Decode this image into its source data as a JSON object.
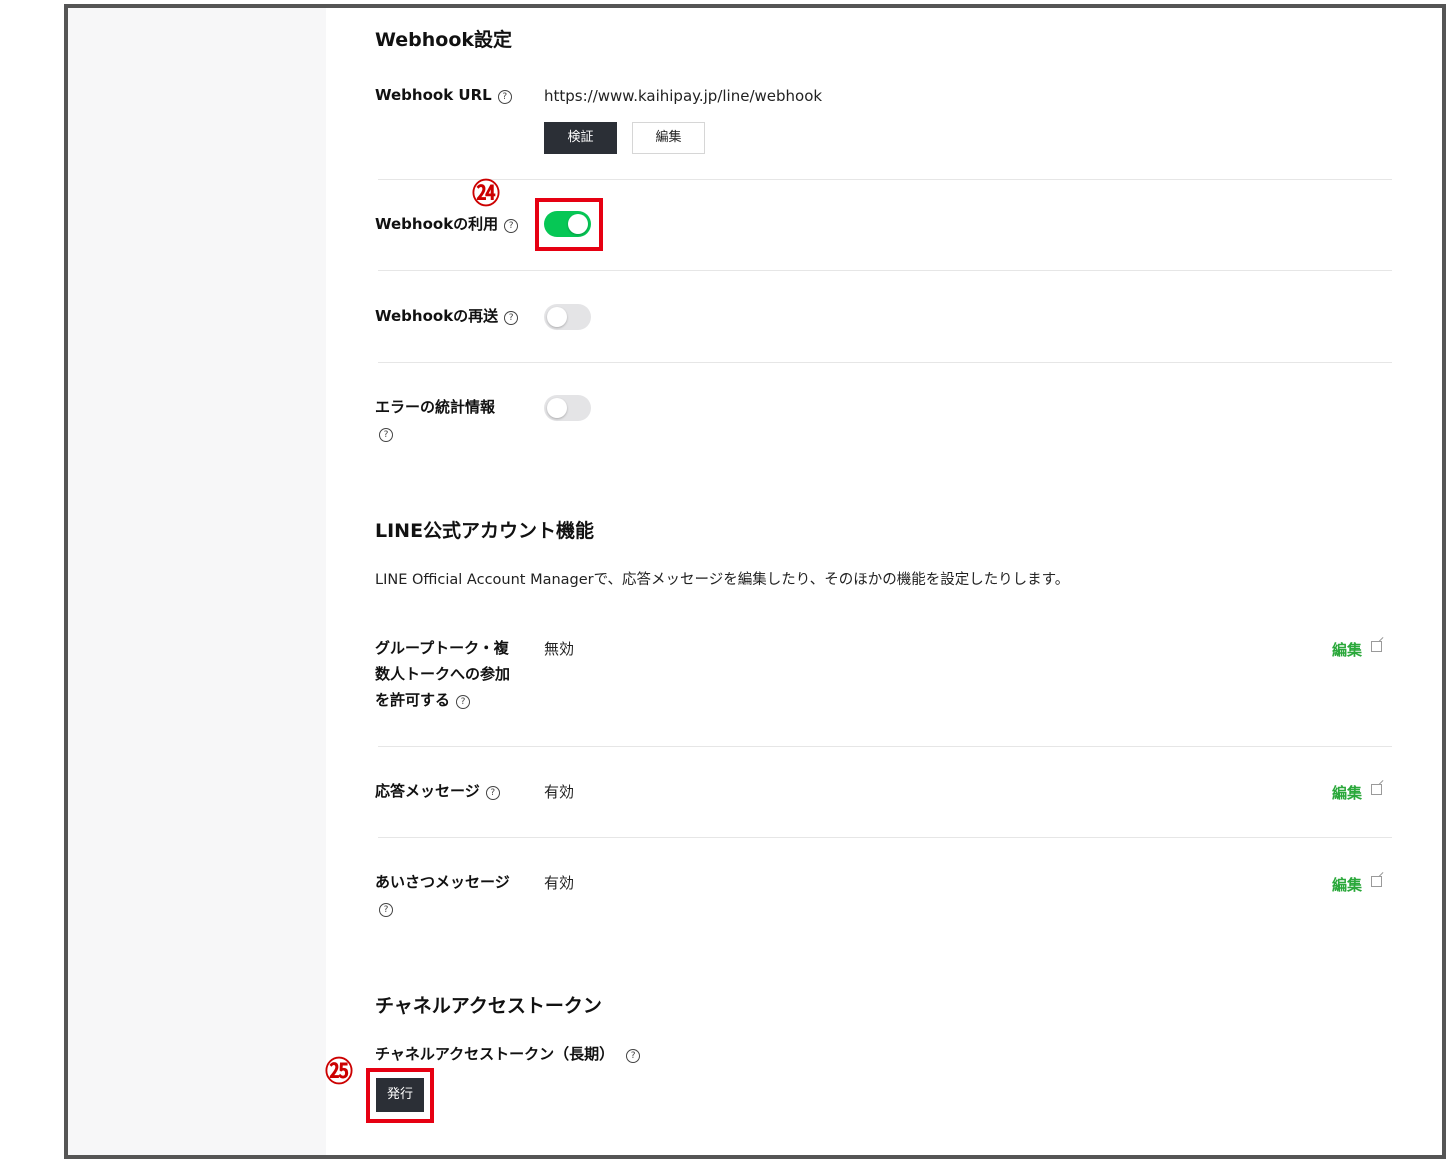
{
  "webhook_section": {
    "title": "Webhook設定",
    "url_label": "Webhook URL",
    "url_value": "https://www.kaihipay.jp/line/webhook",
    "verify_button": "検証",
    "edit_button": "編集",
    "use_label": "Webhookの利用",
    "use_enabled": true,
    "resend_label": "Webhookの再送",
    "resend_enabled": false,
    "error_stats_label": "エラーの統計情報",
    "error_stats_enabled": false
  },
  "account_features": {
    "title": "LINE公式アカウント機能",
    "description": "LINE Official Account Managerで、応答メッセージを編集したり、そのほかの機能を設定したりします。",
    "rows": [
      {
        "label_lines": [
          "グループトーク・複",
          "数人トークへの参加",
          "を許可する"
        ],
        "value": "無効",
        "link": "編集"
      },
      {
        "label_lines": [
          "応答メッセージ"
        ],
        "value": "有効",
        "link": "編集"
      },
      {
        "label_lines": [
          "あいさつメッセージ"
        ],
        "value": "有効",
        "link": "編集"
      }
    ]
  },
  "token_section": {
    "title": "チャネルアクセストークン",
    "long_term_label": "チャネルアクセストークン（長期）",
    "issue_button": "発行"
  },
  "annotations": {
    "callout_24": "㉔",
    "callout_25": "㉕",
    "highlight_color": "#e60012"
  },
  "colors": {
    "toggle_on": "#06c755",
    "toggle_off": "#e4e4e6",
    "link_green": "#2aa83a",
    "dark_button": "#2b2f36"
  },
  "help_icon": "?"
}
